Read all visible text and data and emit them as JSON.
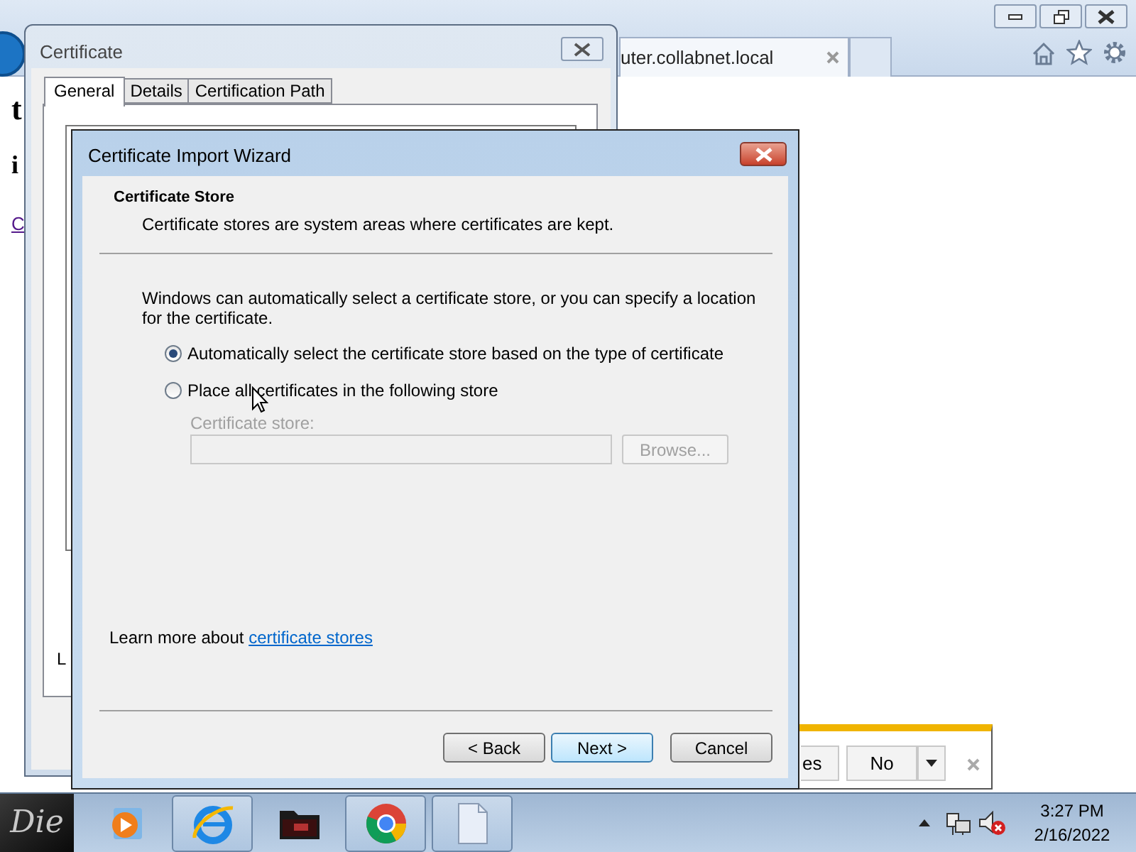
{
  "browser": {
    "tab_title": "uter.collabnet.local"
  },
  "page": {
    "heading": "t",
    "line": "i",
    "link": "C"
  },
  "notification_bar": {
    "buttons": [
      {
        "label": "es"
      },
      {
        "label": "No"
      }
    ]
  },
  "certificate_dialog": {
    "title": "Certificate",
    "tabs": [
      {
        "label": "General",
        "selected": true
      },
      {
        "label": "Details",
        "selected": false
      },
      {
        "label": "Certification Path",
        "selected": false
      }
    ],
    "partial_text": "L"
  },
  "wizard": {
    "title": "Certificate Import Wizard",
    "header": "Certificate Store",
    "subtitle": "Certificate stores are system areas where certificates are kept.",
    "intro": "Windows can automatically select a certificate store, or you can specify a location for the certificate.",
    "options": [
      {
        "label": "Automatically select the certificate store based on the type of certificate",
        "selected": true
      },
      {
        "label": "Place all certificates in the following store",
        "selected": false
      }
    ],
    "store_field": {
      "label": "Certificate store:",
      "disabled": true
    },
    "browse_button": {
      "label": "Browse...",
      "disabled": true
    },
    "learn_more": {
      "text": "Learn more about",
      "link": "certificate stores"
    },
    "buttons": [
      {
        "label": "< Back",
        "focused": false
      },
      {
        "label": "Next >",
        "focused": true
      },
      {
        "label": "Cancel",
        "focused": false
      }
    ]
  },
  "taskbar": {
    "start_label": "Die",
    "apps": [
      {
        "kind": "media",
        "running": false
      },
      {
        "kind": "ie",
        "running": true
      },
      {
        "kind": "folder",
        "running": false
      },
      {
        "kind": "chrome",
        "running": true
      },
      {
        "kind": "file",
        "running": true
      }
    ],
    "clock": {
      "time": "3:27 PM",
      "date": "2/16/2022"
    }
  }
}
